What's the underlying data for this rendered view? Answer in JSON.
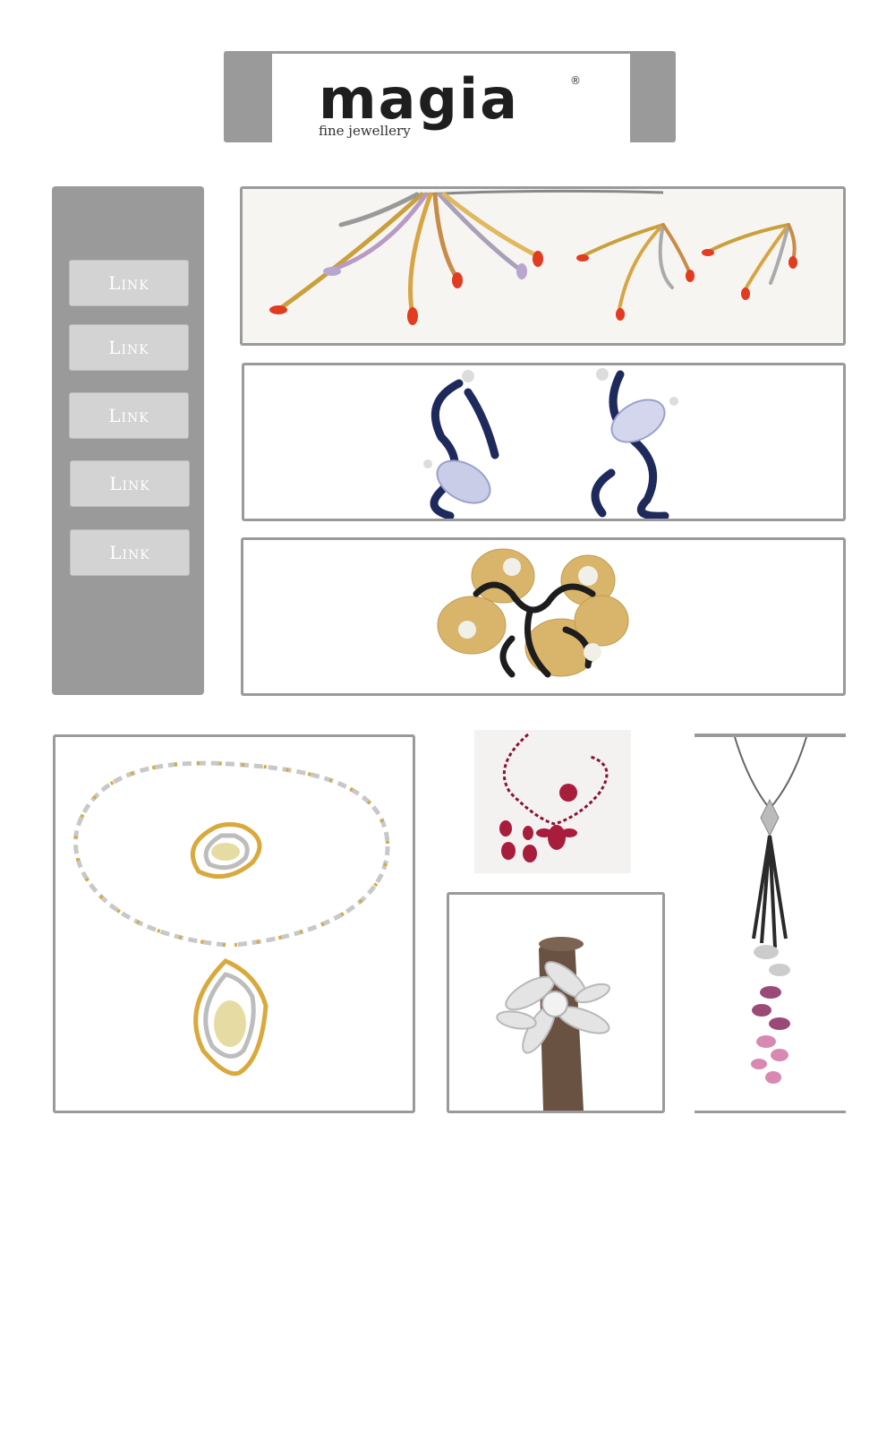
{
  "header": {
    "logo_text": "magia",
    "logo_tagline": "fine jewellery",
    "logo_mark": "®"
  },
  "sidebar": {
    "links": [
      {
        "label": "Link"
      },
      {
        "label": "Link"
      },
      {
        "label": "Link"
      },
      {
        "label": "Link"
      },
      {
        "label": "Link"
      }
    ]
  },
  "banners": [
    {
      "icon": "coral-feather-necklace-earrings-image"
    },
    {
      "icon": "sapphire-moonstone-earrings-image"
    },
    {
      "icon": "gold-floral-pendant-image"
    }
  ],
  "gallery": [
    {
      "icon": "gold-diamond-necklace-ring-image"
    },
    {
      "icon": "ruby-jewellery-set-image"
    },
    {
      "icon": "diamond-flower-ring-image"
    },
    {
      "icon": "pink-drop-pendant-image"
    }
  ],
  "colors": {
    "panel_gray": "#9a9a9a",
    "button_gray": "#d3d3d3",
    "background": "#ffffff"
  }
}
